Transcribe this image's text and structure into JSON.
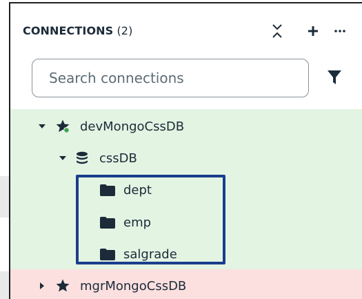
{
  "sidebar": {
    "header": {
      "title": "CONNECTIONS",
      "count": "(2)",
      "collapse_icon": "collapse-all-icon",
      "add_icon": "plus-icon",
      "more_icon": "ellipsis-icon"
    },
    "search": {
      "placeholder": "Search connections",
      "value": ""
    },
    "filter_icon": "filter-funnel-icon",
    "connections": [
      {
        "name": "devMongoCssDB",
        "expanded": true,
        "connected": true,
        "color": "#e3f4e3",
        "databases": [
          {
            "name": "cssDB",
            "expanded": true,
            "collections": [
              "dept",
              "emp",
              "salgrade"
            ]
          }
        ]
      },
      {
        "name": "mgrMongoCssDB",
        "expanded": false,
        "connected": false,
        "color": "#fbe0df"
      }
    ]
  },
  "colors": {
    "highlight_border": "#1a3e8c",
    "connected_dot": "#3fa34d",
    "text": "#1c2b39"
  }
}
